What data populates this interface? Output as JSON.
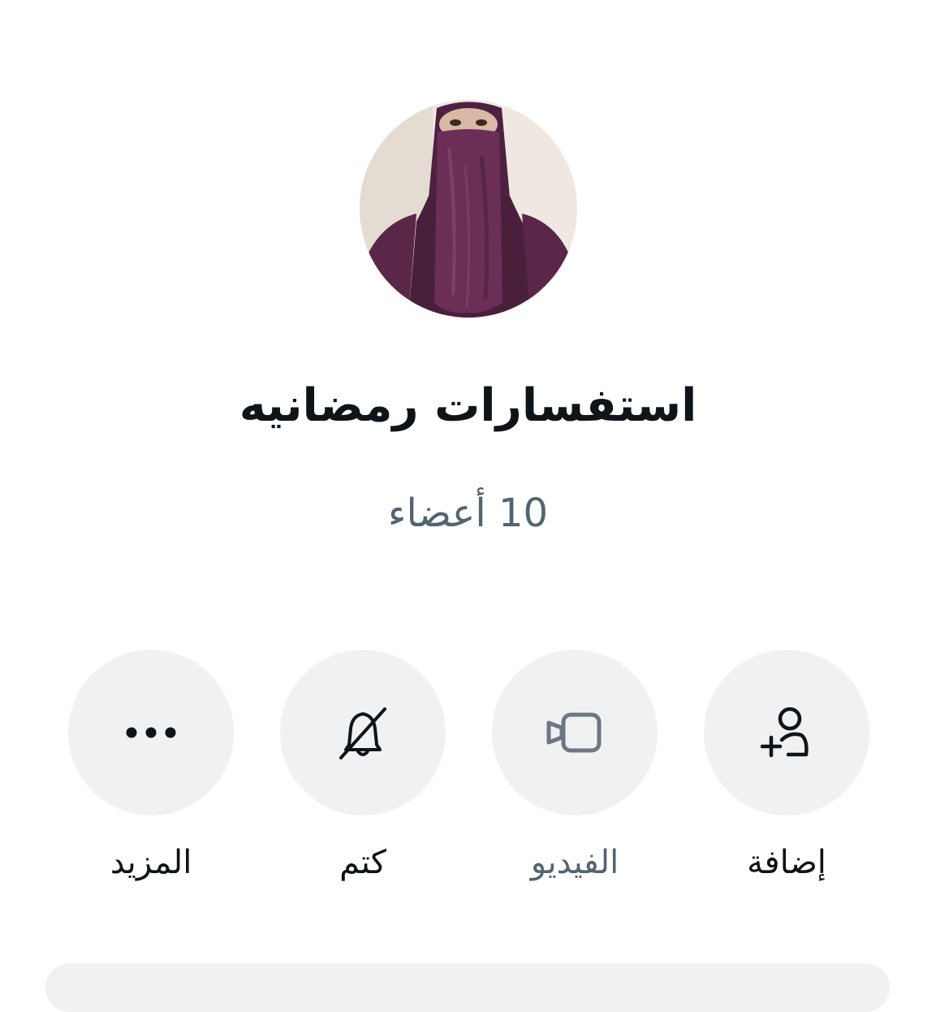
{
  "group": {
    "name": "استفسارات رمضانيه",
    "members": "10 أعضاء"
  },
  "actions": {
    "add": {
      "label": "إضافة",
      "icon": "add-user-icon"
    },
    "video": {
      "label": "الفيديو",
      "icon": "video-camera-icon"
    },
    "mute": {
      "label": "كتم",
      "icon": "bell-off-icon"
    },
    "more": {
      "label": "المزيد",
      "icon": "more-dots-icon"
    }
  },
  "colors": {
    "circle_bg": "#eff1f3",
    "primary_text": "#0f1419",
    "secondary_text": "#536471",
    "avatar_purple": "#5a2748"
  }
}
